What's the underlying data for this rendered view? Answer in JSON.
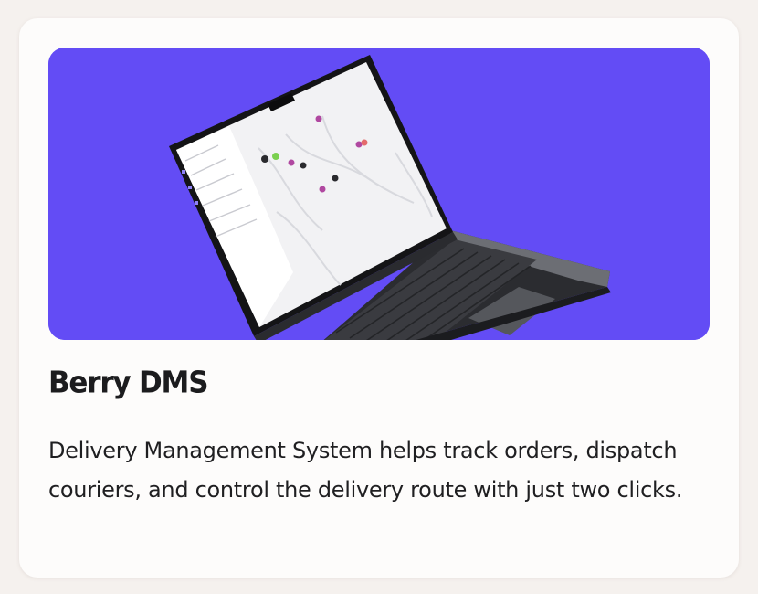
{
  "card": {
    "title": "Berry DMS",
    "description": "Delivery Management System helps track orders, dispatch couriers, and control the delivery route with just two clicks.",
    "image": {
      "subject": "laptop-showing-delivery-map",
      "background_color": "#634cf5"
    }
  },
  "colors": {
    "page_background": "#f5f1ee",
    "card_background": "#fdfcfb",
    "text": "#1f1f21",
    "accent": "#634cf5"
  }
}
